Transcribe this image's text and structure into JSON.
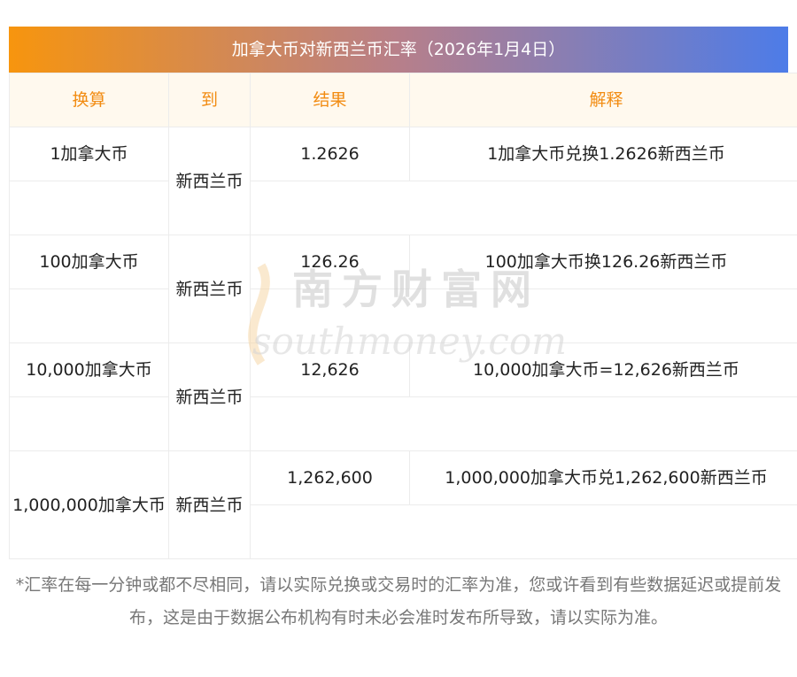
{
  "title": "加拿大币对新西兰币汇率（2026年1月4日）",
  "headers": [
    "换算",
    "到",
    "结果",
    "解释"
  ],
  "rows": [
    {
      "from": "1加拿大币",
      "to": "新西兰币",
      "result": "1.2626",
      "explain": "1加拿大币兑换1.2626新西兰币"
    },
    {
      "from": "100加拿大币",
      "to": "新西兰币",
      "result": "126.26",
      "explain": "100加拿大币换126.26新西兰币"
    },
    {
      "from": "10,000加拿大币",
      "to": "新西兰币",
      "result": "12,626",
      "explain": "10,000加拿大币=12,626新西兰币"
    },
    {
      "from": "1,000,000加拿大币",
      "to": "新西兰币",
      "result": "1,262,600",
      "explain": "1,000,000加拿大币兑1,262,600新西兰币"
    }
  ],
  "watermark": {
    "cn": "南方财富网",
    "en": "southmoney.com"
  },
  "note": "*汇率在每一分钟或都不尽相同，请以实际兑换或交易时的汇率为准，您或许看到有些数据延迟或提前发布，这是由于数据公布机构有时未必会准时发布所导致，请以实际为准。",
  "colors": {
    "header_text": "#f28c12",
    "gradient_start": "#f7950e",
    "gradient_end": "#4d7ce8"
  }
}
